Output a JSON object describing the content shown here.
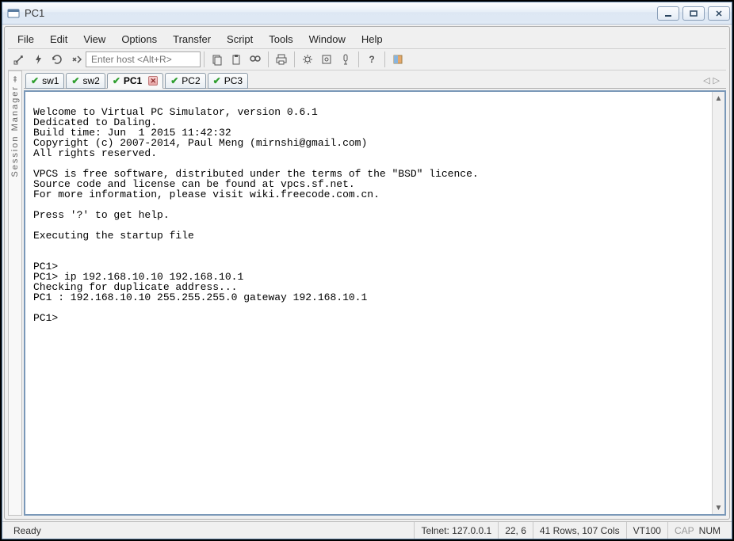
{
  "window": {
    "title": "PC1"
  },
  "menu": {
    "items": [
      "File",
      "Edit",
      "View",
      "Options",
      "Transfer",
      "Script",
      "Tools",
      "Window",
      "Help"
    ]
  },
  "toolbar": {
    "host_placeholder": "Enter host <Alt+R>"
  },
  "sidebar": {
    "label": "Session Manager"
  },
  "tabs": {
    "items": [
      {
        "label": "sw1",
        "active": false,
        "closeable": false
      },
      {
        "label": "sw2",
        "active": false,
        "closeable": false
      },
      {
        "label": "PC1",
        "active": true,
        "closeable": true
      },
      {
        "label": "PC2",
        "active": false,
        "closeable": false
      },
      {
        "label": "PC3",
        "active": false,
        "closeable": false
      }
    ],
    "arrow_left": "◁",
    "arrow_right": "▷"
  },
  "terminal": {
    "text": "\nWelcome to Virtual PC Simulator, version 0.6.1\nDedicated to Daling.\nBuild time: Jun  1 2015 11:42:32\nCopyright (c) 2007-2014, Paul Meng (mirnshi@gmail.com)\nAll rights reserved.\n\nVPCS is free software, distributed under the terms of the \"BSD\" licence.\nSource code and license can be found at vpcs.sf.net.\nFor more information, please visit wiki.freecode.com.cn.\n\nPress '?' to get help.\n\nExecuting the startup file\n\n\nPC1>\nPC1> ip 192.168.10.10 192.168.10.1\nChecking for duplicate address...\nPC1 : 192.168.10.10 255.255.255.0 gateway 192.168.10.1\n\nPC1>"
  },
  "status": {
    "ready": "Ready",
    "protocol": "Telnet: 127.0.0.1",
    "cursor": "22,   6",
    "size": "41 Rows, 107 Cols",
    "emulation": "VT100",
    "cap": "CAP",
    "num": "NUM"
  }
}
